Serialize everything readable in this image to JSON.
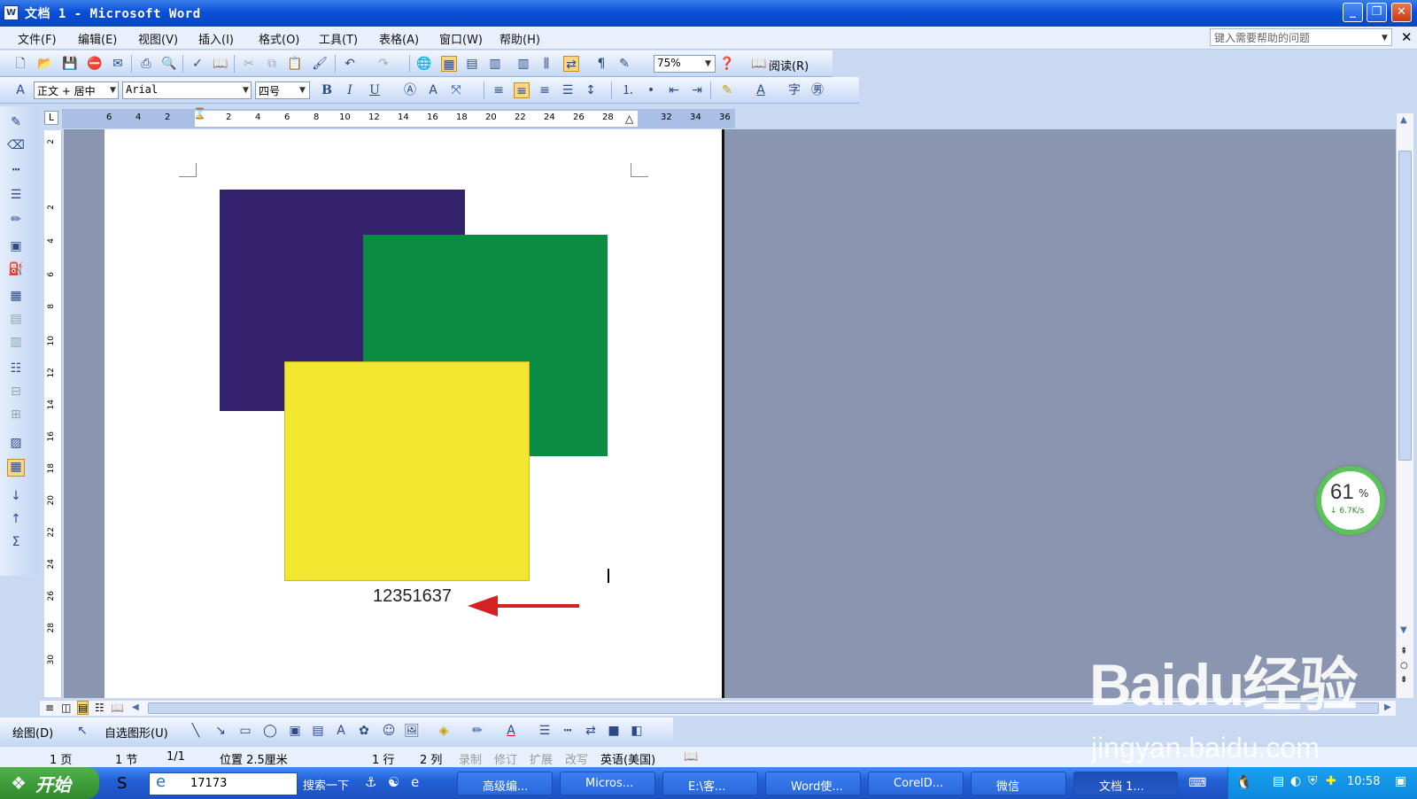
{
  "window": {
    "title": "文档 1 - Microsoft Word",
    "app_icon": "W"
  },
  "menu": {
    "items": [
      "文件(F)",
      "编辑(E)",
      "视图(V)",
      "插入(I)",
      "格式(O)",
      "工具(T)",
      "表格(A)",
      "窗口(W)",
      "帮助(H)"
    ],
    "help_placeholder": "键入需要帮助的问题"
  },
  "standard_toolbar": {
    "zoom": "75%",
    "read_label": "阅读(R)"
  },
  "format_toolbar": {
    "style": "正文 + 居中",
    "font": "Arial",
    "size": "四号",
    "bold": "B",
    "italic": "I",
    "underline": "U"
  },
  "ruler": {
    "h_ticks": [
      "6",
      "4",
      "2",
      "2",
      "4",
      "6",
      "8",
      "10",
      "12",
      "14",
      "16",
      "18",
      "20",
      "22",
      "24",
      "26",
      "28",
      "32",
      "34",
      "36"
    ],
    "v_ticks": [
      "2",
      "2",
      "4",
      "6",
      "8",
      "10",
      "12",
      "14",
      "16",
      "18",
      "20",
      "22",
      "24",
      "26",
      "28",
      "30"
    ]
  },
  "document": {
    "number_text": "12351637",
    "colors": {
      "purple": "#34216b",
      "green": "#0a8d42",
      "yellow": "#f2e630",
      "arrow": "#d42222"
    }
  },
  "draw_toolbar": {
    "draw_label": "绘图(D)",
    "autoshape_label": "自选图形(U)"
  },
  "status": {
    "page": "1 页",
    "section": "1 节",
    "pages": "1/1",
    "position": "位置 2.5厘米",
    "line": "1 行",
    "column": "2 列",
    "rec": "录制",
    "trk": "修订",
    "ext": "扩展",
    "ovr": "改写",
    "language": "英语(美国)"
  },
  "taskbar": {
    "start": "开始",
    "address": "17173",
    "search": "搜索一下",
    "tasks": [
      "高级编...",
      "Micros...",
      "E:\\客...",
      "Word使...",
      "CorelD...",
      "微信",
      "文档 1..."
    ],
    "clock": "10:58"
  },
  "gauge": {
    "percent": "61",
    "unit": "%",
    "speed": "↓ 6.7K/s"
  },
  "watermark": {
    "brand": "Baidu经验",
    "url": "jingyan.baidu.com"
  }
}
